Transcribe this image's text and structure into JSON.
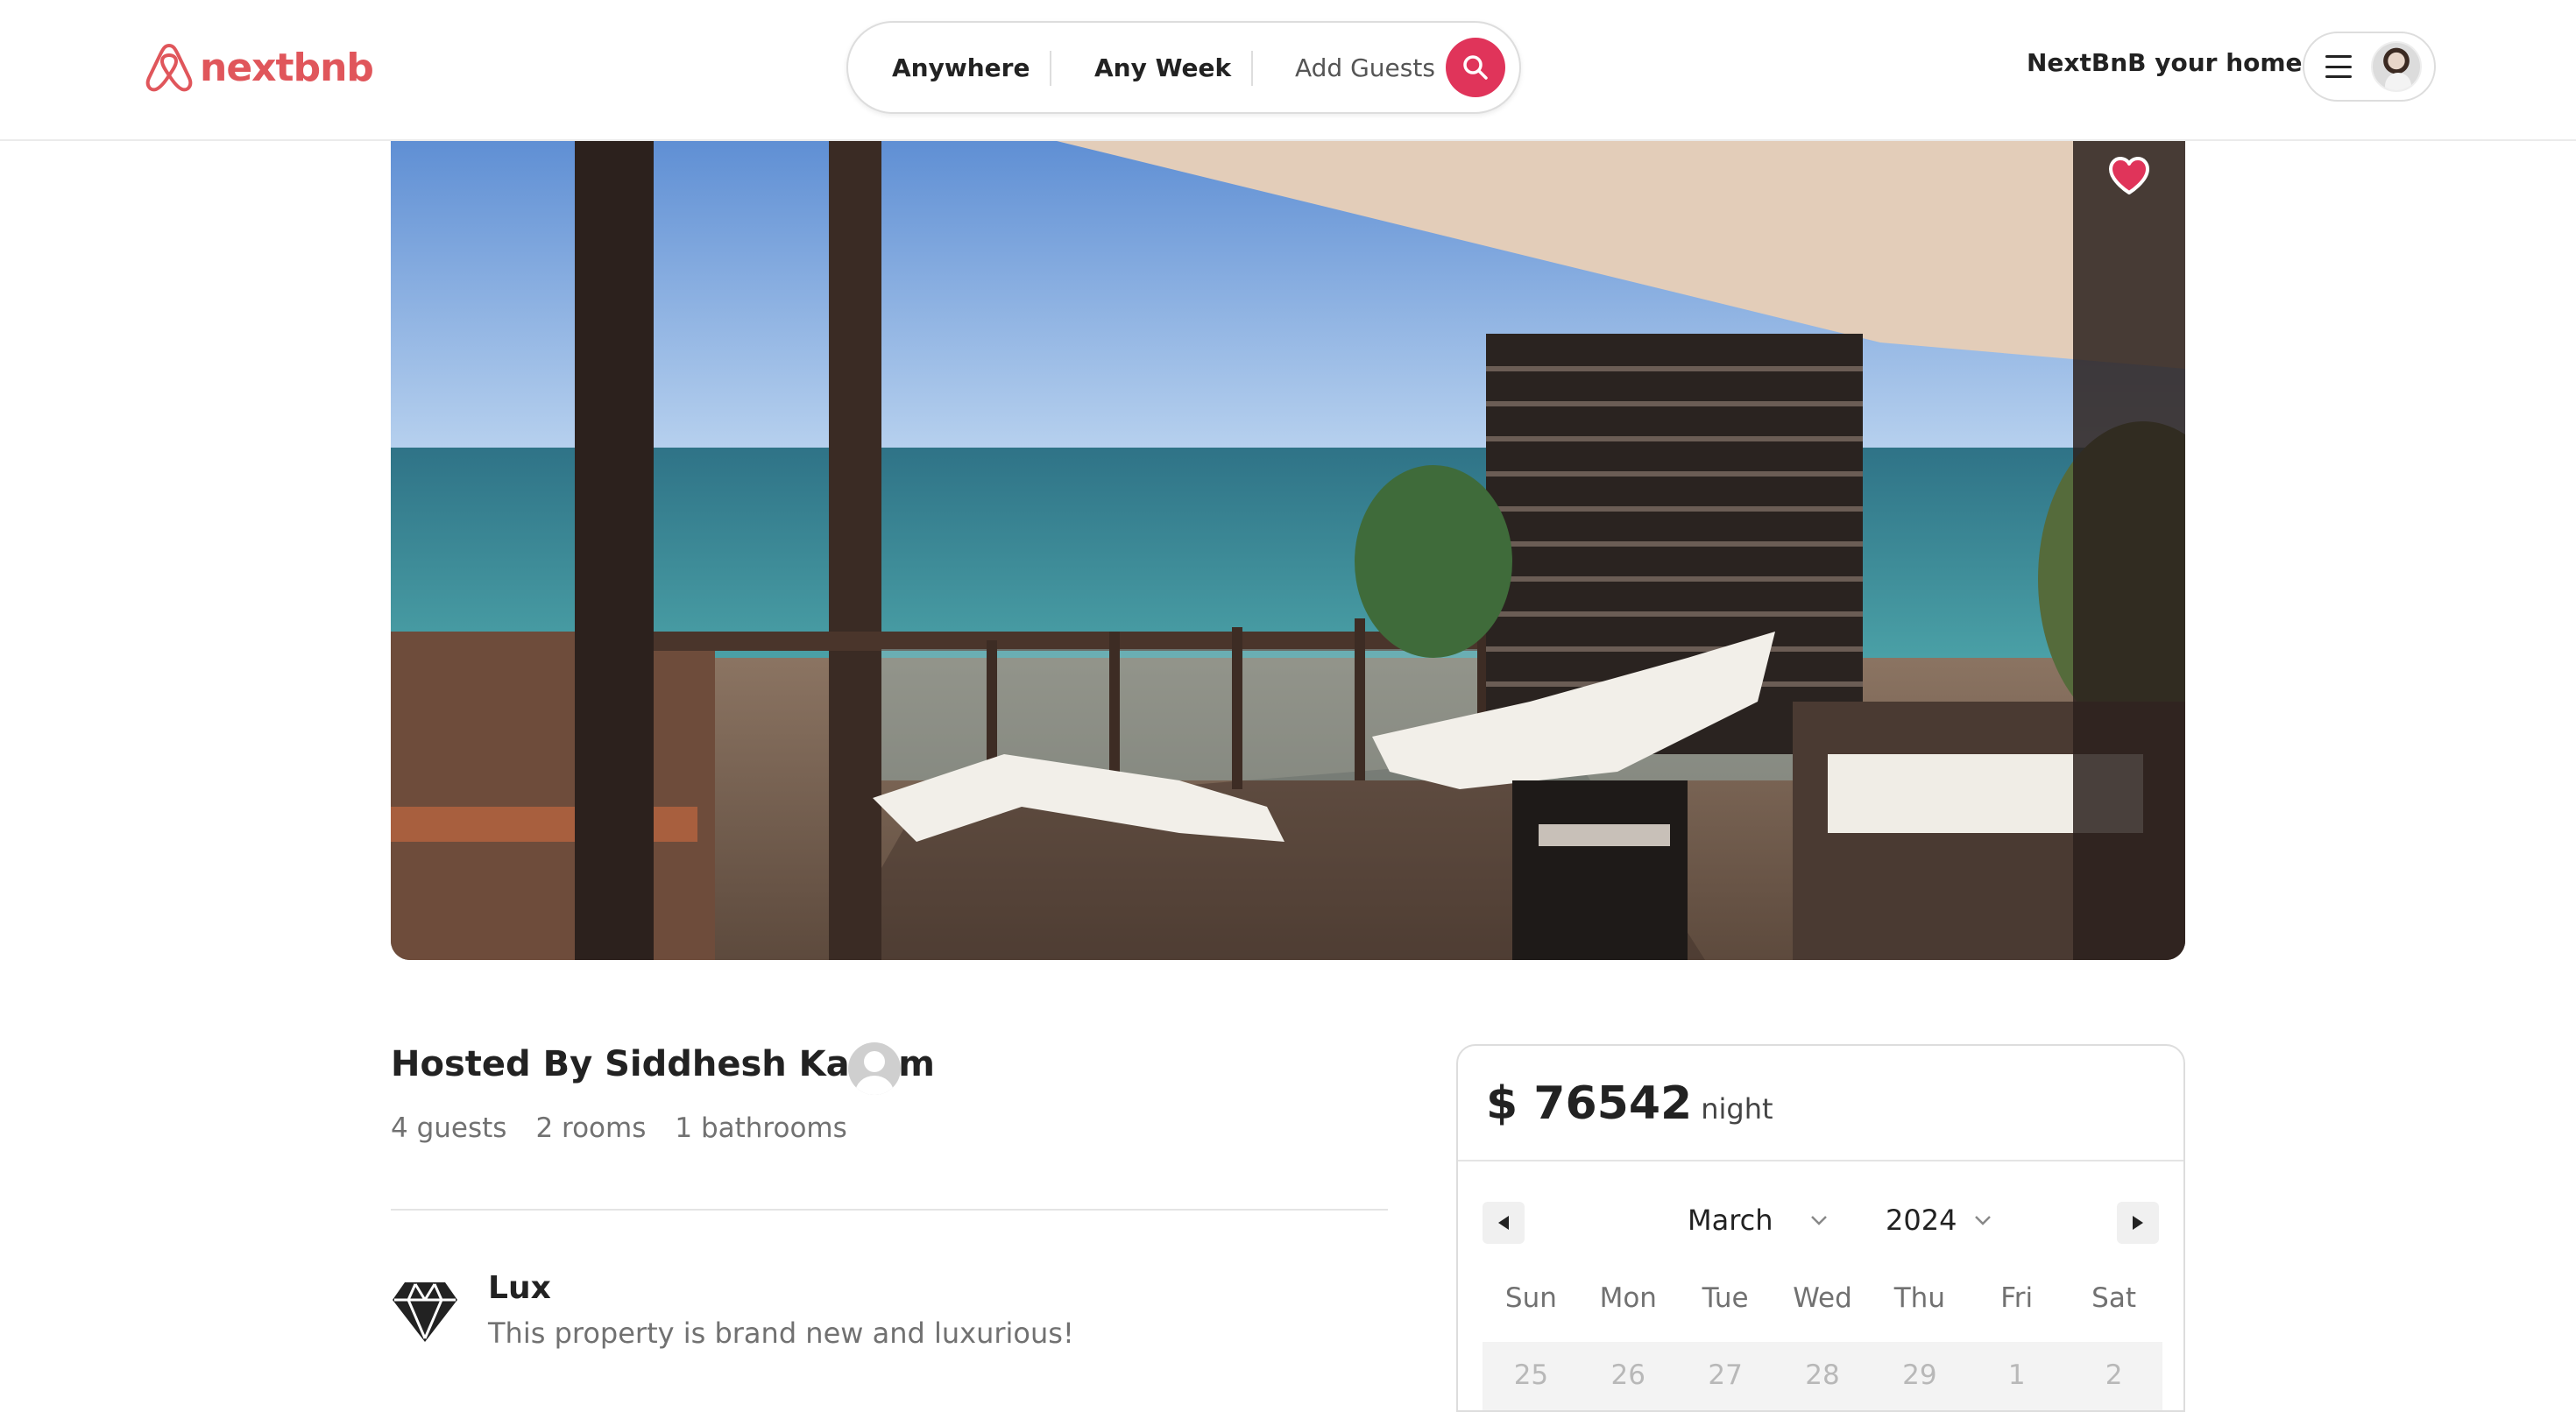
{
  "header": {
    "logo_text": "nextbnb",
    "search": {
      "anywhere": "Anywhere",
      "any_week": "Any Week",
      "add_guests": "Add Guests"
    },
    "host_link": "NextBnB your home",
    "icons": {
      "logo": "airbnb-logo-icon",
      "search": "search-icon",
      "menu": "hamburger-menu-icon",
      "avatar": "user-avatar"
    }
  },
  "hero": {
    "image": "balcony-sea-view-photo",
    "favorite_icon": "heart-icon"
  },
  "listing": {
    "host_title": "Hosted By Siddhesh Kadam",
    "stats": [
      "4 guests",
      "2 rooms",
      "1 bathrooms"
    ],
    "feature": {
      "icon": "diamond-icon",
      "title": "Lux",
      "description": "This property is brand new and luxurious!"
    }
  },
  "booking": {
    "price": "$ 76542",
    "per": "night",
    "calendar": {
      "month": "March",
      "year": "2024",
      "weekdays": [
        "Sun",
        "Mon",
        "Tue",
        "Wed",
        "Thu",
        "Fri",
        "Sat"
      ],
      "first_row": [
        "25",
        "26",
        "27",
        "28",
        "29",
        "1",
        "2"
      ]
    }
  },
  "colors": {
    "brand": "#e0565b",
    "search_button": "#e0345a",
    "heart": "#e0345a",
    "muted_text": "#717171"
  }
}
